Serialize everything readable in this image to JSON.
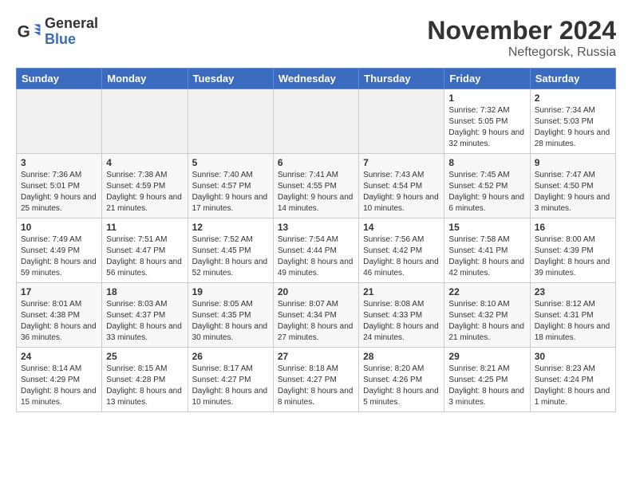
{
  "header": {
    "logo_general": "General",
    "logo_blue": "Blue",
    "title": "November 2024",
    "subtitle": "Neftegorsk, Russia"
  },
  "weekdays": [
    "Sunday",
    "Monday",
    "Tuesday",
    "Wednesday",
    "Thursday",
    "Friday",
    "Saturday"
  ],
  "weeks": [
    [
      {
        "day": "",
        "info": ""
      },
      {
        "day": "",
        "info": ""
      },
      {
        "day": "",
        "info": ""
      },
      {
        "day": "",
        "info": ""
      },
      {
        "day": "",
        "info": ""
      },
      {
        "day": "1",
        "info": "Sunrise: 7:32 AM\nSunset: 5:05 PM\nDaylight: 9 hours and 32 minutes."
      },
      {
        "day": "2",
        "info": "Sunrise: 7:34 AM\nSunset: 5:03 PM\nDaylight: 9 hours and 28 minutes."
      }
    ],
    [
      {
        "day": "3",
        "info": "Sunrise: 7:36 AM\nSunset: 5:01 PM\nDaylight: 9 hours and 25 minutes."
      },
      {
        "day": "4",
        "info": "Sunrise: 7:38 AM\nSunset: 4:59 PM\nDaylight: 9 hours and 21 minutes."
      },
      {
        "day": "5",
        "info": "Sunrise: 7:40 AM\nSunset: 4:57 PM\nDaylight: 9 hours and 17 minutes."
      },
      {
        "day": "6",
        "info": "Sunrise: 7:41 AM\nSunset: 4:55 PM\nDaylight: 9 hours and 14 minutes."
      },
      {
        "day": "7",
        "info": "Sunrise: 7:43 AM\nSunset: 4:54 PM\nDaylight: 9 hours and 10 minutes."
      },
      {
        "day": "8",
        "info": "Sunrise: 7:45 AM\nSunset: 4:52 PM\nDaylight: 9 hours and 6 minutes."
      },
      {
        "day": "9",
        "info": "Sunrise: 7:47 AM\nSunset: 4:50 PM\nDaylight: 9 hours and 3 minutes."
      }
    ],
    [
      {
        "day": "10",
        "info": "Sunrise: 7:49 AM\nSunset: 4:49 PM\nDaylight: 8 hours and 59 minutes."
      },
      {
        "day": "11",
        "info": "Sunrise: 7:51 AM\nSunset: 4:47 PM\nDaylight: 8 hours and 56 minutes."
      },
      {
        "day": "12",
        "info": "Sunrise: 7:52 AM\nSunset: 4:45 PM\nDaylight: 8 hours and 52 minutes."
      },
      {
        "day": "13",
        "info": "Sunrise: 7:54 AM\nSunset: 4:44 PM\nDaylight: 8 hours and 49 minutes."
      },
      {
        "day": "14",
        "info": "Sunrise: 7:56 AM\nSunset: 4:42 PM\nDaylight: 8 hours and 46 minutes."
      },
      {
        "day": "15",
        "info": "Sunrise: 7:58 AM\nSunset: 4:41 PM\nDaylight: 8 hours and 42 minutes."
      },
      {
        "day": "16",
        "info": "Sunrise: 8:00 AM\nSunset: 4:39 PM\nDaylight: 8 hours and 39 minutes."
      }
    ],
    [
      {
        "day": "17",
        "info": "Sunrise: 8:01 AM\nSunset: 4:38 PM\nDaylight: 8 hours and 36 minutes."
      },
      {
        "day": "18",
        "info": "Sunrise: 8:03 AM\nSunset: 4:37 PM\nDaylight: 8 hours and 33 minutes."
      },
      {
        "day": "19",
        "info": "Sunrise: 8:05 AM\nSunset: 4:35 PM\nDaylight: 8 hours and 30 minutes."
      },
      {
        "day": "20",
        "info": "Sunrise: 8:07 AM\nSunset: 4:34 PM\nDaylight: 8 hours and 27 minutes."
      },
      {
        "day": "21",
        "info": "Sunrise: 8:08 AM\nSunset: 4:33 PM\nDaylight: 8 hours and 24 minutes."
      },
      {
        "day": "22",
        "info": "Sunrise: 8:10 AM\nSunset: 4:32 PM\nDaylight: 8 hours and 21 minutes."
      },
      {
        "day": "23",
        "info": "Sunrise: 8:12 AM\nSunset: 4:31 PM\nDaylight: 8 hours and 18 minutes."
      }
    ],
    [
      {
        "day": "24",
        "info": "Sunrise: 8:14 AM\nSunset: 4:29 PM\nDaylight: 8 hours and 15 minutes."
      },
      {
        "day": "25",
        "info": "Sunrise: 8:15 AM\nSunset: 4:28 PM\nDaylight: 8 hours and 13 minutes."
      },
      {
        "day": "26",
        "info": "Sunrise: 8:17 AM\nSunset: 4:27 PM\nDaylight: 8 hours and 10 minutes."
      },
      {
        "day": "27",
        "info": "Sunrise: 8:18 AM\nSunset: 4:27 PM\nDaylight: 8 hours and 8 minutes."
      },
      {
        "day": "28",
        "info": "Sunrise: 8:20 AM\nSunset: 4:26 PM\nDaylight: 8 hours and 5 minutes."
      },
      {
        "day": "29",
        "info": "Sunrise: 8:21 AM\nSunset: 4:25 PM\nDaylight: 8 hours and 3 minutes."
      },
      {
        "day": "30",
        "info": "Sunrise: 8:23 AM\nSunset: 4:24 PM\nDaylight: 8 hours and 1 minute."
      }
    ]
  ]
}
